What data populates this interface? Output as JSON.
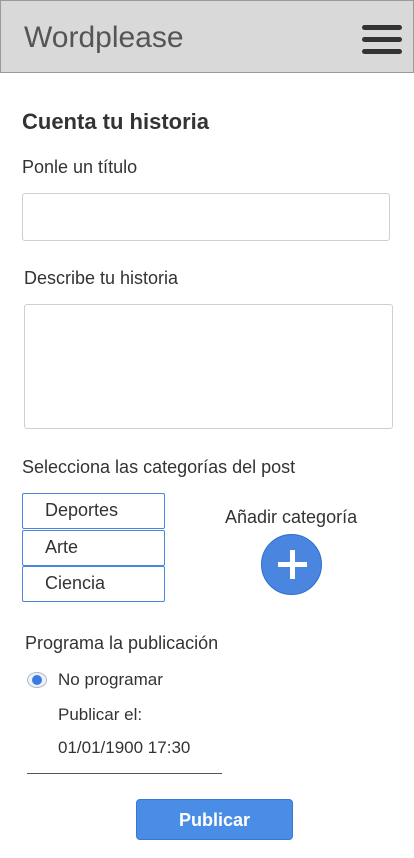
{
  "app": {
    "title": "Wordplease"
  },
  "form": {
    "heading": "Cuenta tu historia",
    "title_label": "Ponle un título",
    "title_value": "",
    "story_label": "Describe tu historia",
    "story_value": "",
    "categories_label": "Selecciona las categorías del post",
    "categories": [
      "Deportes",
      "Arte",
      "Ciencia"
    ],
    "add_category_label": "Añadir categoría",
    "schedule_label": "Programa la publicación",
    "no_schedule_label": "No programar",
    "publish_on_label": "Publicar el:",
    "publish_datetime": "01/01/1900 17:30",
    "publish_button": "Publicar"
  },
  "icons": {
    "menu": "hamburger-menu-icon",
    "add": "plus-icon",
    "radio": "radio-selected-icon"
  },
  "colors": {
    "accent": "#4a86e0",
    "appbar": "#d9d9d9"
  }
}
